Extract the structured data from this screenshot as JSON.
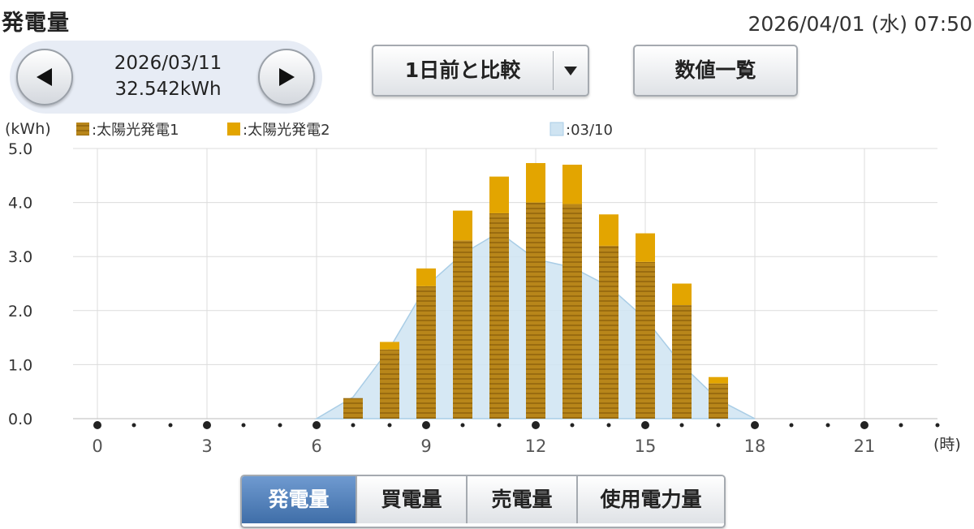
{
  "header": {
    "title": "発電量",
    "datetime": "2026/04/01 (水) 07:50"
  },
  "nav": {
    "date": "2026/03/11",
    "total": "32.542kWh",
    "prev_icon": "left-triangle",
    "next_icon": "right-triangle"
  },
  "compare_dropdown": {
    "selected": "1日前と比較",
    "icon": "down-triangle"
  },
  "numlist_button": "数値一覧",
  "tabs": [
    {
      "label": "発電量",
      "active": true
    },
    {
      "label": "買電量",
      "active": false
    },
    {
      "label": "売電量",
      "active": false
    },
    {
      "label": "使用電力量",
      "active": false
    }
  ],
  "colors": {
    "solar1": "#b8861a",
    "solar1_stripe": "#9a6c10",
    "solar2": "#e3a500",
    "compare": "#cfe4f2",
    "compare_line": "#a9cde6",
    "active_tab": "#4f7fbc"
  },
  "chart_data": {
    "type": "bar",
    "ylabel": "(kWh)",
    "xlabel": "(時)",
    "ylim": [
      0,
      5
    ],
    "yticks": [
      "0.0",
      "1.0",
      "2.0",
      "3.0",
      "4.0",
      "5.0"
    ],
    "xticks": [
      "0",
      "3",
      "6",
      "9",
      "12",
      "15",
      "18",
      "21"
    ],
    "xlim": [
      0,
      23
    ],
    "grid": true,
    "legend_position": "top",
    "series": [
      {
        "name": ":太陽光発電1",
        "kind": "stacked-bar",
        "x": [
          7,
          8,
          9,
          10,
          11,
          12,
          13,
          14,
          15,
          16,
          17
        ],
        "values": [
          0.38,
          1.28,
          2.45,
          3.3,
          3.8,
          4.0,
          3.97,
          3.2,
          2.9,
          2.1,
          0.65
        ]
      },
      {
        "name": ":太陽光発電2",
        "kind": "stacked-bar",
        "x": [
          7,
          8,
          9,
          10,
          11,
          12,
          13,
          14,
          15,
          16,
          17
        ],
        "values": [
          0.0,
          0.14,
          0.33,
          0.55,
          0.68,
          0.73,
          0.73,
          0.58,
          0.53,
          0.4,
          0.12
        ]
      },
      {
        "name": ":03/10",
        "kind": "area",
        "x": [
          6,
          7,
          8,
          9,
          10,
          11,
          12,
          13,
          14,
          15,
          16,
          17,
          18
        ],
        "values": [
          0.0,
          0.4,
          1.3,
          2.45,
          3.05,
          3.45,
          2.95,
          2.8,
          2.45,
          1.85,
          1.0,
          0.35,
          0.0
        ]
      }
    ]
  }
}
